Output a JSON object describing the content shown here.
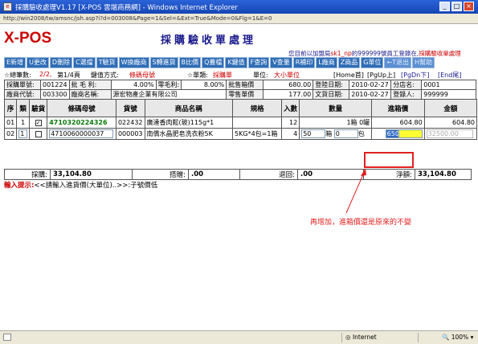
{
  "window": {
    "title": "採購驗收處理V1.17 [X-POS 雲端商務網] - Windows Internet Explorer",
    "address": "http://win2008/tw/amsnc/jsh.asp?i?d=003008&Page=1&Sel=&Ext=True&Mode=0&Flg=1&E=0"
  },
  "header": {
    "logo": "X-POS",
    "page_title": "採購驗收單處理",
    "notice_prefix": "您目前以加盟局",
    "notice_user": "sk1_np",
    "notice_mid": "的999999號員工登錄在,",
    "notice_func": "採購驗收單處理"
  },
  "toolbar": {
    "buttons": [
      "E新增",
      "U更改",
      "D刪除",
      "C選擋",
      "T驗貨",
      "W換廠商",
      "S轉進貨",
      "B比價",
      "Q蓋檔",
      "K鍵值",
      "F查詢",
      "V查量",
      "R補印",
      "L廠商",
      "Z商品",
      "G單位",
      "←T退出",
      "H幫助"
    ]
  },
  "status_line": {
    "total_label": "☆總筆數:",
    "total_value": "2/2,",
    "page_label": "第1/4頁",
    "key_label": "鍵值方式:",
    "key_value": "條碼母號",
    "doc_label": "☆單類:",
    "doc_value": "採購單",
    "unit_label": "單位:",
    "unit_value": "大小單位",
    "nav_home": "[Home首]",
    "nav_pgup": "[PgUp上]",
    "nav_pgdn": "[PgDn下]",
    "nav_end": "[End尾]"
  },
  "header_fields": {
    "row1": {
      "po_label": "採購單號:",
      "po_value": "001224",
      "margin_label": "批 毛 利:",
      "margin_value": "4.00%",
      "zero_margin_label": "零毛利:",
      "zero_margin_value": "8.00%",
      "wholesale_label": "批售箱價",
      "wholesale_value": "680.00",
      "reg_date_label": "登陸日期:",
      "reg_date_value": "2010-02-27",
      "branch_label": "分店名:",
      "branch_value": "0001"
    },
    "row2": {
      "vendor_code_label": "廠商代號:",
      "vendor_code_value": "003300",
      "vendor_name_label": "廠商名稱:",
      "vendor_name_value": "源宏物產企業有限公司",
      "retail_label": "零售單價",
      "retail_value": "177.00",
      "doc_date_label": "文貨日期:",
      "doc_date_value": "2010-02-27",
      "user_label": "登錄人:",
      "user_value": "999999"
    }
  },
  "grid": {
    "columns": [
      "序",
      "類",
      "驗貨",
      "條碼母號",
      "貨號",
      "商品名稱",
      "規格",
      "入數",
      "數量",
      "進箱價",
      "金額"
    ],
    "rows": [
      {
        "seq": "01",
        "type": "1",
        "checked": "✓",
        "barcode": "4710320224326",
        "item_no": "022432",
        "name": "廣達香肉鬆(玻)115g*1",
        "spec": "",
        "inner_qty": "12",
        "qty_text": "1箱 0罐",
        "box_price": "604.80",
        "amount": "604.80"
      },
      {
        "seq": "02",
        "type": "1",
        "checked": "",
        "barcode": "4710060000037",
        "item_no": "000003",
        "name": "南僑水晶肥皂洗衣粉5K",
        "spec": "5KG*4包=1箱",
        "inner_qty": "4",
        "qty_box": "50",
        "qty_box_unit": "箱",
        "qty_pack": "0",
        "qty_pack_unit": "包",
        "box_price": "650",
        "amount": "32500.00"
      }
    ]
  },
  "totals": {
    "purchase_label": "採購:",
    "purchase_value": "33,104.80",
    "discount_label": "搭贈:",
    "discount_value": ".00",
    "return_label": "退回:",
    "return_value": ".00",
    "net_label": "淨額:",
    "net_value": "33,104.80"
  },
  "hint": {
    "label": "輸入提示:",
    "text": "<<請輸入進貨價(大單位)..>>:子號價低"
  },
  "annotation": "再增加，進箱價還是原來的不變",
  "statusbar": {
    "zone": "Internet",
    "zoom": "100%"
  }
}
